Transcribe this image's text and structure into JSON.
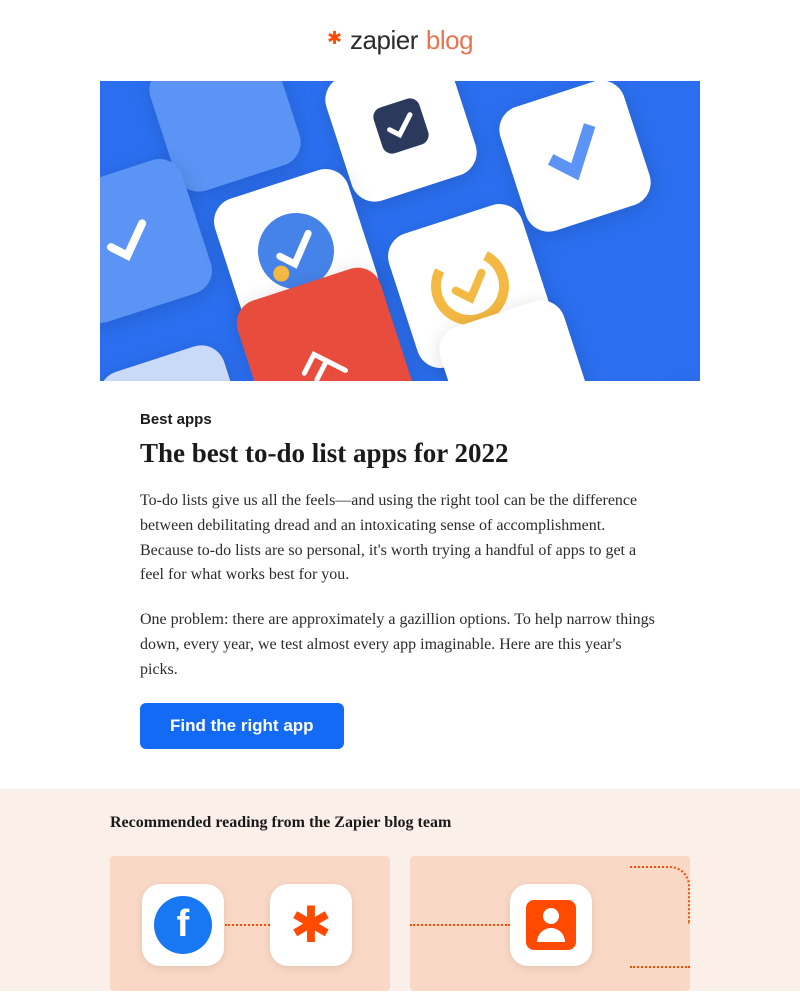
{
  "header": {
    "logo_text_1": "zapier",
    "logo_text_2": "blog"
  },
  "article": {
    "category": "Best apps",
    "title": "The best to-do list apps for 2022",
    "paragraph_1": "To-do lists give us all the feels—and using the right tool can be the difference between debilitating dread and an intoxicating sense of accomplishment. Because to-do lists are so personal, it's worth trying a handful of apps to get a feel for what works best for you.",
    "paragraph_2": "One problem: there are approximately a gazillion options. To help narrow things down, every year, we test almost every app imaginable. Here are this year's picks.",
    "cta_label": "Find the right app"
  },
  "recommended": {
    "heading": "Recommended reading from the Zapier blog team"
  }
}
